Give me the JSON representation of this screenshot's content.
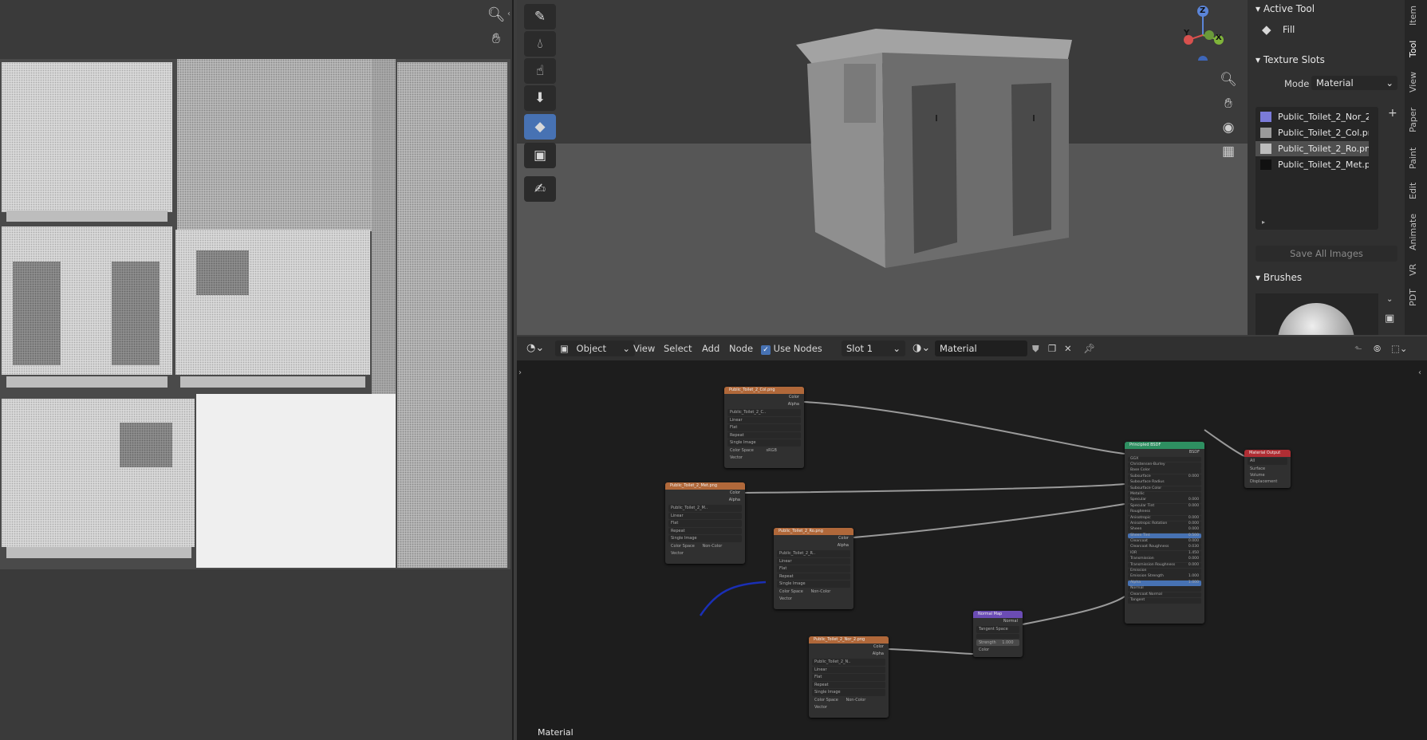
{
  "uv_editor": {
    "zoom_icon": "zoom-icon",
    "pan_icon": "hand-icon"
  },
  "tools": [
    "brush-icon",
    "drop-icon",
    "smear-icon",
    "stamp-icon",
    "fill-icon",
    "mask-icon",
    "annotate-icon"
  ],
  "viewport": {
    "gizmo_z": "Z",
    "gizmo_y": "Y",
    "gizmo_x": "X"
  },
  "right_panel": {
    "active_tool_header": "Active Tool",
    "active_tool_name": "Fill",
    "texture_slots_header": "Texture Slots",
    "mode_label": "Mode",
    "mode_value": "Material",
    "slots": [
      {
        "name": "Public_Toilet_2_Nor_2...",
        "color": "#7b7bd9"
      },
      {
        "name": "Public_Toilet_2_Col.png",
        "color": "#9a9a9a"
      },
      {
        "name": "Public_Toilet_2_Ro.png",
        "color": "#bcbcbc"
      },
      {
        "name": "Public_Toilet_2_Met.p...",
        "color": "#111111"
      }
    ],
    "save_all_images": "Save All Images",
    "brushes_header": "Brushes"
  },
  "side_tabs": [
    "Item",
    "Tool",
    "View",
    "Paper",
    "Paint",
    "Edit",
    "Animate",
    "VR",
    "PDT"
  ],
  "node_editor": {
    "object_mode": "Object",
    "menu": [
      "View",
      "Select",
      "Add",
      "Node"
    ],
    "use_nodes": "Use Nodes",
    "slot": "Slot 1",
    "material": "Material",
    "footer_label": "Material"
  },
  "nodes": {
    "col": {
      "title": "Public_Toilet_2_Col.png",
      "image": "Public_Toilet_2_C..",
      "rows": [
        "Linear",
        "Flat",
        "Repeat",
        "Single Image"
      ],
      "color_space": "Color Space",
      "color_space_value": "sRGB",
      "vector": "Vector",
      "out_color": "Color",
      "out_alpha": "Alpha"
    },
    "met": {
      "title": "Public_Toilet_2_Met.png",
      "image": "Public_Toilet_2_M..",
      "rows": [
        "Linear",
        "Flat",
        "Repeat",
        "Single Image"
      ],
      "color_space": "Color Space",
      "color_space_value": "Non-Color",
      "vector": "Vector",
      "out_color": "Color",
      "out_alpha": "Alpha"
    },
    "ro": {
      "title": "Public_Toilet_2_Ro.png",
      "image": "Public_Toilet_2_R..",
      "rows": [
        "Linear",
        "Flat",
        "Repeat",
        "Single Image"
      ],
      "color_space": "Color Space",
      "color_space_value": "Non-Color",
      "vector": "Vector",
      "out_color": "Color",
      "out_alpha": "Alpha"
    },
    "nor": {
      "title": "Public_Toilet_2_Nor_2.png",
      "image": "Public_Toilet_2_N..",
      "rows": [
        "Linear",
        "Flat",
        "Repeat",
        "Single Image"
      ],
      "color_space": "Color Space",
      "color_space_value": "Non-Color",
      "vector": "Vector",
      "out_color": "Color",
      "out_alpha": "Alpha"
    },
    "normal_map": {
      "title": "Normal Map",
      "out": "Normal",
      "space": "Tangent Space",
      "strength": "Strength",
      "strength_value": "1.000",
      "in_color": "Color"
    },
    "bsdf": {
      "title": "Principled BSDF",
      "out": "BSDF",
      "rows": [
        "GGX",
        "Christensen-Burley",
        "Base Color",
        "Subsurface",
        "Subsurface Radius",
        "Subsurface Color",
        "Metallic",
        "Specular",
        "Specular Tint",
        "Roughness",
        "Anisotropic",
        "Anisotropic Rotation",
        "Sheen",
        "Sheen Tint",
        "Clearcoat",
        "Clearcoat Roughness",
        "IOR",
        "Transmission",
        "Transmission Roughness",
        "Emission",
        "Emission Strength",
        "Alpha",
        "Normal",
        "Clearcoat Normal",
        "Tangent"
      ],
      "values": [
        "",
        "",
        "",
        "0.000",
        "",
        "",
        "",
        "0.000",
        "0.000",
        "",
        "0.000",
        "0.000",
        "0.000",
        "0.500",
        "0.000",
        "0.030",
        "1.450",
        "0.000",
        "0.000",
        "",
        "1.000",
        "1.000",
        "",
        "",
        ""
      ]
    },
    "output": {
      "title": "Material Output",
      "target": "All",
      "rows": [
        "Surface",
        "Volume",
        "Displacement"
      ]
    }
  }
}
